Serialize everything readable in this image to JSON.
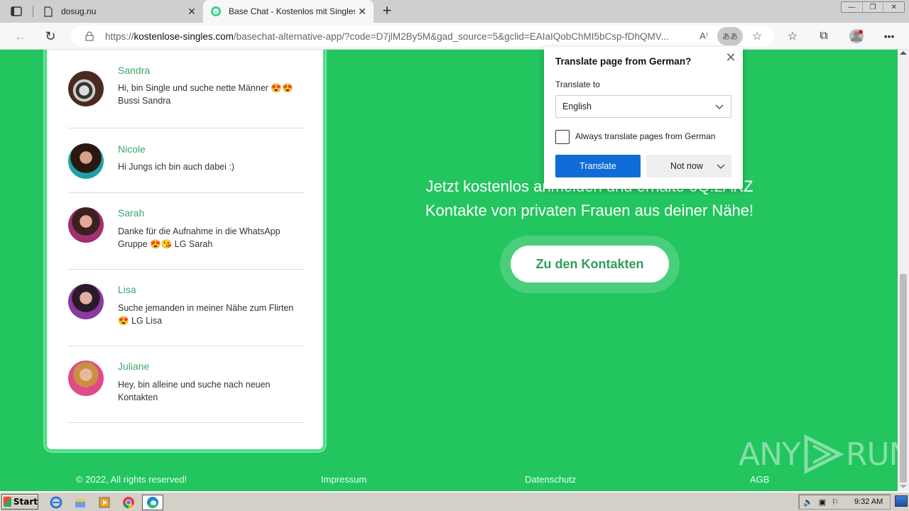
{
  "browser": {
    "tabs": [
      {
        "title": "dosug.nu",
        "icon": "document-icon",
        "active": false
      },
      {
        "title": "Base Chat - Kostenlos mit Singles",
        "icon": "chat-bubble-icon",
        "active": true
      }
    ],
    "new_tab_label": "+",
    "address": {
      "url_scheme": "https://",
      "url_host": "kostenlose-singles.com",
      "url_rest": "/basechat-alternative-app/?code=D7jlM2By5M&gad_source=5&gclid=EAIaIQobChMI5bCsp-fDhQMV..."
    },
    "translate_pill_label": "ああ",
    "read_aloud_label": "A⁾"
  },
  "sidebar_messages": [
    {
      "name": "Sandra",
      "text": "Hi, bin Single und suche nette Männer 😍😍 Bussi Sandra"
    },
    {
      "name": "Nicole",
      "text": "Hi Jungs ich bin auch dabei :)"
    },
    {
      "name": "Sarah",
      "text": "Danke für die Aufnahme in die WhatsApp Gruppe 😍😘 LG Sarah"
    },
    {
      "name": "Lisa",
      "text": "Suche jemanden in meiner Nähe zum Flirten 😍 LG Lisa"
    },
    {
      "name": "Juliane",
      "text": "Hey, bin alleine und suche nach neuen Kontakten"
    }
  ],
  "main": {
    "promo_line1": "Jetzt kostenlos anmelden und erhalte 6Q.2AKZ",
    "promo_line2": "Kontakte von privaten Frauen aus deiner Nähe!",
    "cta_label": "Zu den Kontakten"
  },
  "footer": {
    "copyright": "© 2022, All rights reserved!",
    "links": [
      "Impressum",
      "Datenschutz",
      "AGB"
    ]
  },
  "watermark": "ANY RUN",
  "translate_popup": {
    "title": "Translate page from  German?",
    "translate_to_label": "Translate to",
    "selected_language": "English",
    "always_translate_label": "Always translate pages from German",
    "always_translate_checked": false,
    "translate_button": "Translate",
    "not_now_button": "Not now"
  },
  "taskbar": {
    "start_label": "Start",
    "clock": "9:32 AM",
    "apps": [
      "internet-explorer-icon",
      "file-explorer-icon",
      "media-player-icon",
      "chrome-icon",
      "edge-icon"
    ]
  },
  "colors": {
    "page_bg": "#22c55e",
    "name_green": "#3aa86a",
    "cta_text": "#2e9e5b",
    "translate_blue": "#0f6cd6"
  }
}
